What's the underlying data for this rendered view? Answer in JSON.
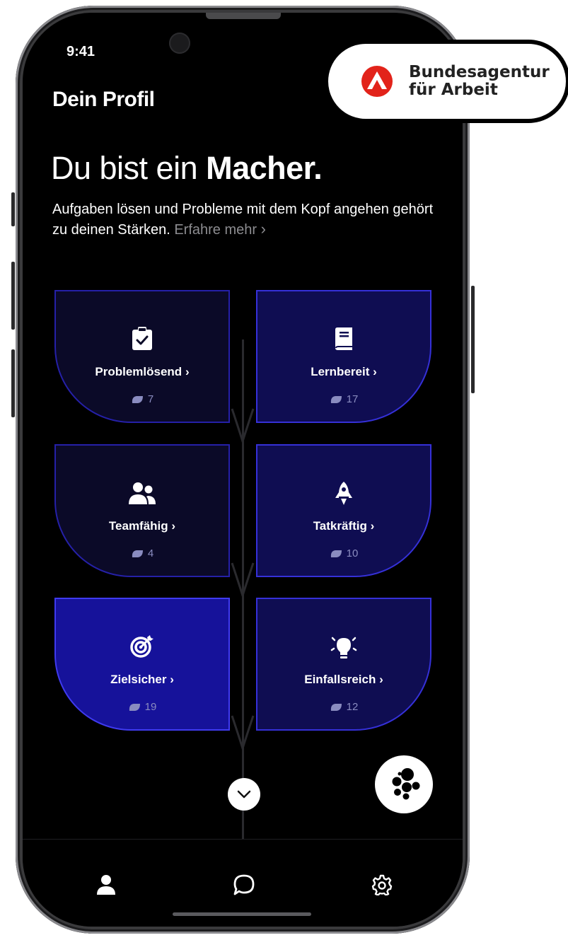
{
  "status_bar": {
    "time": "9:41"
  },
  "header": {
    "title": "Dein Profil"
  },
  "hero": {
    "headline_prefix": "Du bist ein ",
    "headline_bold": "Macher.",
    "description": "Aufgaben lösen und Probleme mit dem Kopf angehen gehört zu deinen Stärken. ",
    "learn_more": "Erfahre mehr",
    "learn_more_chevron": "›"
  },
  "strengths": [
    {
      "label": "Problemlösend",
      "count": "7",
      "icon": "clipboard-check-icon"
    },
    {
      "label": "Lernbereit",
      "count": "17",
      "icon": "book-icon"
    },
    {
      "label": "Teamfähig",
      "count": "4",
      "icon": "users-icon"
    },
    {
      "label": "Tatkräftig",
      "count": "10",
      "icon": "rocket-icon"
    },
    {
      "label": "Zielsicher",
      "count": "19",
      "icon": "target-icon"
    },
    {
      "label": "Einfallsreich",
      "count": "12",
      "icon": "lightbulb-icon"
    }
  ],
  "chevron": "›",
  "tab_bar": {
    "tabs": [
      {
        "name": "profile",
        "icon": "user-icon"
      },
      {
        "name": "chat",
        "icon": "chat-bubble-icon"
      },
      {
        "name": "settings",
        "icon": "gear-icon"
      }
    ]
  },
  "badge": {
    "line1": "Bundesagentur",
    "line2": "für Arbeit",
    "logo_color": "#e2231a"
  },
  "colors": {
    "leaf_border": "#3b35e0",
    "leaf_fill": "#0e0c3c",
    "background": "#000000"
  }
}
